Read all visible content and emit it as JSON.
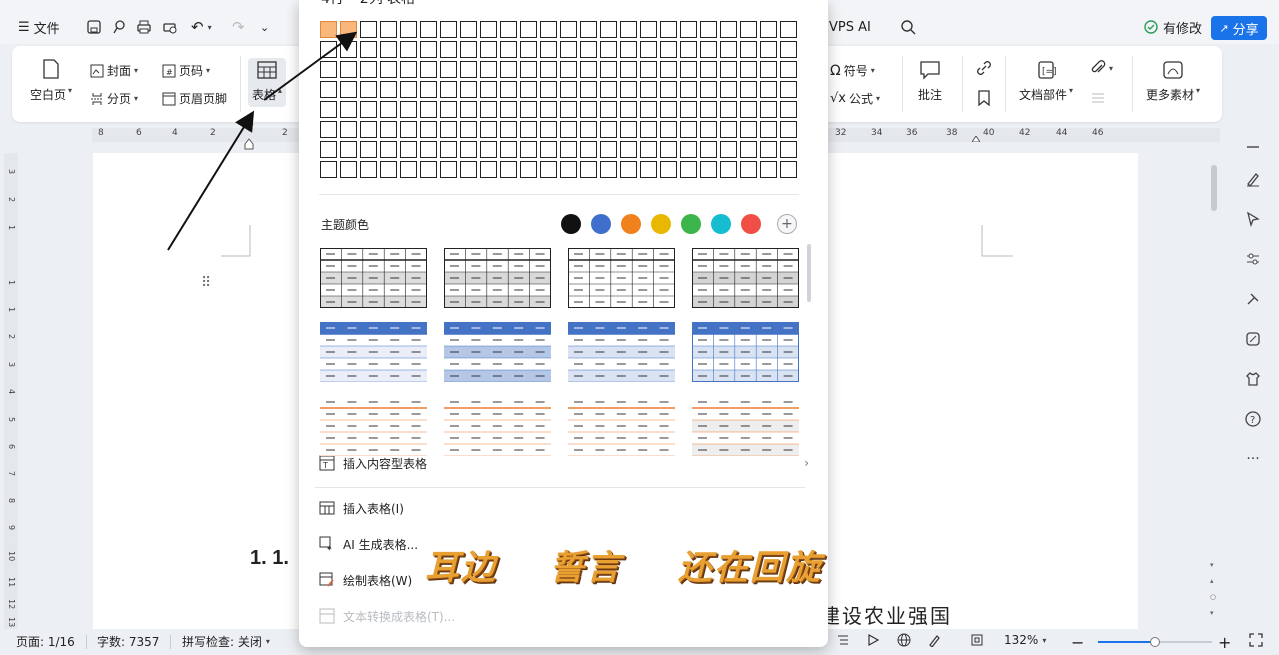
{
  "menubar": {
    "file_label": "文件",
    "vps_ai_label": "VPS AI",
    "modified_label": "有修改",
    "share_label": "分享"
  },
  "ribbon": {
    "cover_label": "封面",
    "page_number_label": "页码",
    "blank_page_label": "空白页",
    "page_break_label": "分页",
    "header_footer_label": "页眉页脚",
    "table_label": "表格",
    "symbol_label": "符号",
    "formula_label": "公式",
    "comment_label": "批注",
    "doc_parts_label": "文档部件",
    "more_materials_label": "更多素材"
  },
  "ruler": {
    "ticks": [
      "8",
      "6",
      "4",
      "2",
      "2",
      "32",
      "34",
      "36",
      "38",
      "40",
      "42",
      "44",
      "46"
    ]
  },
  "vruler": {
    "ticks": [
      "3",
      "2",
      "1",
      "1",
      "1",
      "2",
      "3",
      "4",
      "5",
      "6",
      "7",
      "8",
      "9",
      "10",
      "11",
      "12",
      "13"
    ]
  },
  "dropdown": {
    "title_partial": "4行 * 2列 表格",
    "grid_selected": {
      "rows": 1,
      "cols": 2
    },
    "grid_size": {
      "rows": 8,
      "cols": 24
    },
    "theme_color_label": "主题颜色",
    "theme_colors": [
      "#111111",
      "#3f6fcb",
      "#f0821e",
      "#e8b800",
      "#3bb54a",
      "#16bcd0",
      "#f04f46"
    ],
    "insert_content_table": "插入内容型表格",
    "insert_table": "插入表格(I)",
    "ai_generate_table": "AI 生成表格...",
    "draw_table": "绘制表格(W)",
    "text_to_table": "文本转换成表格(T)..."
  },
  "document": {
    "heading_partial": "1. 1.",
    "body_partial": "建设农业强国"
  },
  "overlay_banner": {
    "text1": "耳边",
    "text2": "誓言",
    "text3": "还在回旋"
  },
  "status": {
    "page": "页面: 1/16",
    "word_count": "字数: 7357",
    "spell_check": "拼写检查: 关闭",
    "zoom": "132%"
  },
  "colors": {
    "accent": "#1a73e8",
    "selected_cell": "#f9b77b",
    "banner": "#e8a033"
  }
}
